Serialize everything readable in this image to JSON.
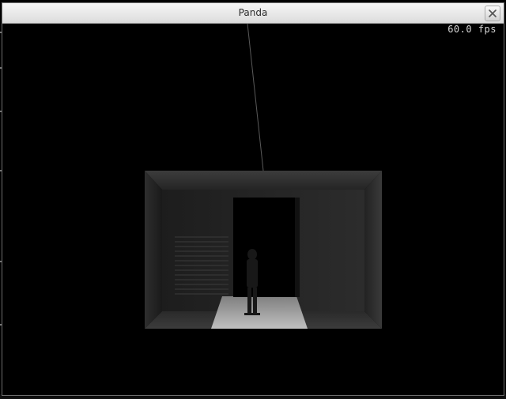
{
  "window": {
    "title": "Panda",
    "close_glyph": "×"
  },
  "viewport": {
    "fps_label": "60.0 fps"
  },
  "icons": {
    "close": "close-icon"
  },
  "colors": {
    "titlebar_top": "#f6f6f6",
    "titlebar_bottom": "#dcdcdc",
    "viewport_bg": "#000000",
    "fps_text": "#d6d6d6"
  }
}
